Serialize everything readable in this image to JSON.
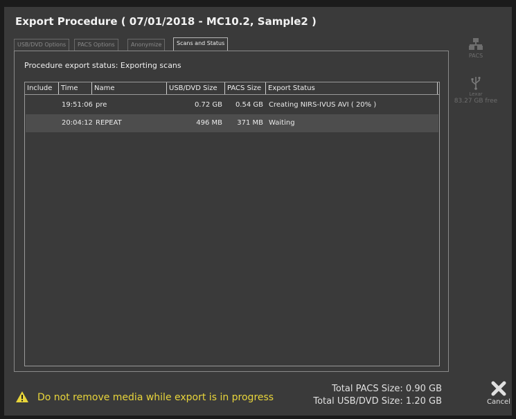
{
  "window": {
    "title": "Export Procedure  ( 07/01/2018 - MC10.2, Sample2 )"
  },
  "tabs": [
    {
      "label": "USB/DVD Options",
      "active": false
    },
    {
      "label": "PACS Options",
      "active": false
    },
    {
      "label": "Anonymize",
      "active": false
    },
    {
      "label": "Scans and Status",
      "active": true
    }
  ],
  "status": {
    "text": "Procedure export status: Exporting scans"
  },
  "table": {
    "columns": [
      "Include",
      "Time",
      "Name",
      "USB/DVD Size",
      "PACS Size",
      "Export Status"
    ],
    "rows": [
      {
        "include": "",
        "time": "19:51:06",
        "name": "pre",
        "usb_size": "0.72 GB",
        "pacs_size": "0.54 GB",
        "status": "Creating NIRS-IVUS AVI ( 20% )"
      },
      {
        "include": "",
        "time": "20:04:12",
        "name": "REPEAT",
        "usb_size": "496 MB",
        "pacs_size": "371 MB",
        "status": "Waiting"
      }
    ]
  },
  "sidebar": {
    "pacs_label": "PACS",
    "usb_label": "Lexar",
    "usb_free": "83.27 GB free"
  },
  "footer": {
    "warning": "Do not remove media while export is in progress",
    "total_pacs": "Total PACS Size: 0.90 GB",
    "total_usb": "Total USB/DVD Size: 1.20 GB",
    "cancel_label": "Cancel"
  },
  "colors": {
    "background": "#3a3a3a",
    "warning": "#e8d53a",
    "row_alt": "#4d4d4d"
  }
}
